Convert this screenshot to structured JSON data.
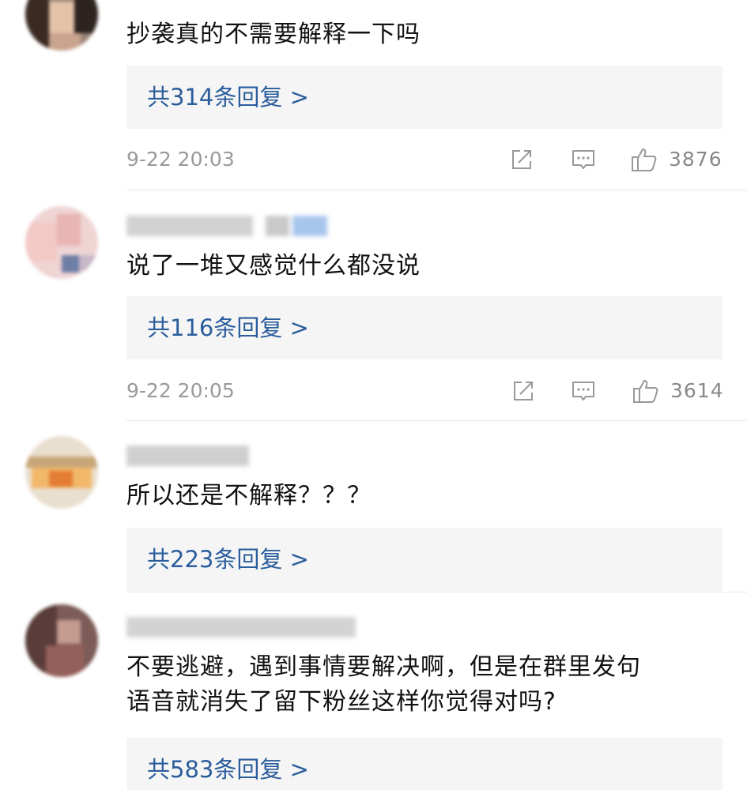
{
  "comments": [
    {
      "text_lines": [
        "抄袭真的不需要解释一下吗"
      ],
      "replies_label": "共314条回复 >",
      "time": "9-22 20:03",
      "likes": "3876"
    },
    {
      "text_lines": [
        "说了一堆又感觉什么都没说"
      ],
      "replies_label": "共116条回复 >",
      "time": "9-22 20:05",
      "likes": "3614"
    },
    {
      "text_lines": [
        "所以还是不解释？？？"
      ],
      "replies_label": "共223条回复 >",
      "time": "",
      "likes": ""
    },
    {
      "text_lines": [
        "不要逃避，遇到事情要解决啊，但是在群里发句",
        "语音就消失了留下粉丝这样你觉得对吗?"
      ],
      "replies_label": "共583条回复 >",
      "time": "",
      "likes": ""
    }
  ],
  "icons": {
    "share": "share-icon",
    "comment": "comment-icon",
    "like": "thumbs-up-icon"
  },
  "colors": {
    "reply_link": "#2a5d9c",
    "reply_bg": "#f5f5f5",
    "meta_text": "#9a9a9a"
  }
}
